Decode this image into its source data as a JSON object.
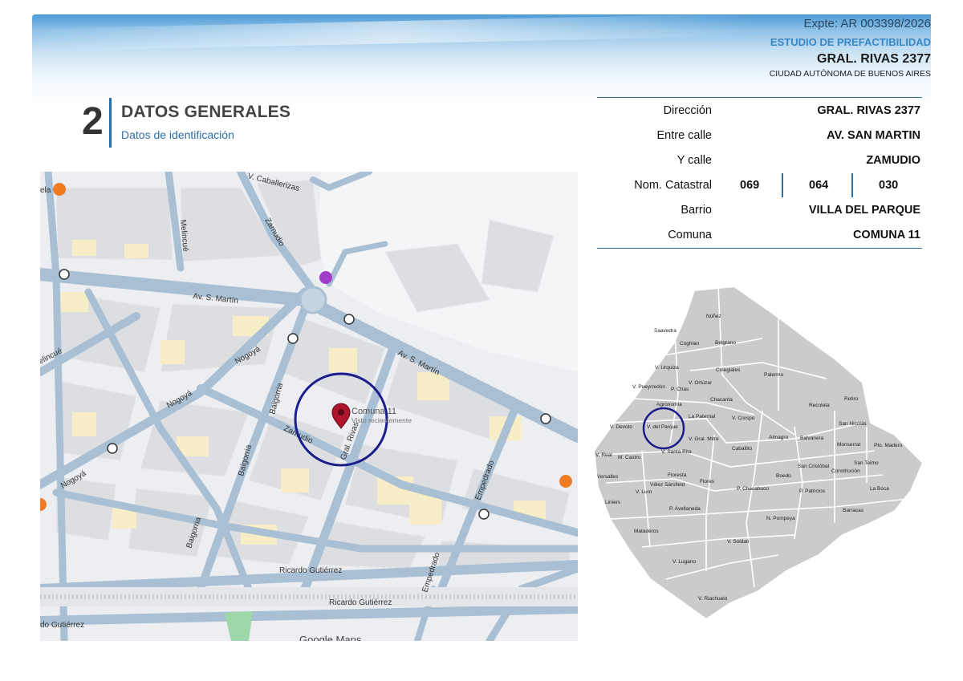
{
  "header": {
    "expte": "Expte: AR 003398/2026",
    "estudio": "ESTUDIO DE PREFACTIBILIDAD",
    "address": "GRAL. RIVAS 2377",
    "city": "CIUDAD AUTÓNOMA DE BUENOS AIRES"
  },
  "section": {
    "number": "2",
    "title": "DATOS GENERALES",
    "subtitle": "Datos de identificación"
  },
  "info": {
    "direccion_label": "Dirección",
    "direccion_value": "GRAL. RIVAS 2377",
    "entre_label": "Entre calle",
    "entre_value": "AV. SAN MARTIN",
    "ycalle_label": "Y calle",
    "ycalle_value": "ZAMUDIO",
    "catastral_label": "Nom. Catastral",
    "catastral_1": "069",
    "catastral_2": "064",
    "catastral_3": "030",
    "barrio_label": "Barrio",
    "barrio_value": "VILLA DEL PARQUE",
    "comuna_label": "Comuna",
    "comuna_value": "COMUNA 11"
  },
  "street_map": {
    "streets": {
      "caballerizas": "V. Caballerizas",
      "melincue": "Melincué",
      "melincue_left": "elincué",
      "zamudio_north": "Zamudio",
      "av_sm_1": "Av. S. Martín",
      "av_sm_2": "Av. S. Martín",
      "nogoya_1": "Nogoyá",
      "nogoya_2": "Nogoyá",
      "nogoya_3": "Nogoyá",
      "baigorria_1": "Baigorria",
      "baigorria_2": "Baigorria",
      "baigorria_3": "Baigorria",
      "zamudio": "Zamudio",
      "gral_rivas": "Gral. Rivas",
      "empedrado_1": "Empedrado",
      "empedrado_2": "Empedrado",
      "ricardo_1": "Ricardo Gutiérrez",
      "ricardo_2": "Ricardo Gutiérrez",
      "ricardo_3": "do Gutiérrez",
      "pela": "ela"
    },
    "marker_title": "Comuna 11",
    "marker_sub": "Visto recientemente",
    "footer_brand": "Google Maps",
    "colors": {
      "road": "#a9bfd3",
      "block": "#dfe1e4",
      "highlight_circle": "#1c1c8c",
      "marker": "#b0132c"
    }
  },
  "context_map": {
    "labels": {
      "nunez": "Núñez",
      "saavedra": "Saavedra",
      "coghlan": "Coghlan",
      "belgrano": "Belgrano",
      "v_urquiza": "V. Urquiza",
      "colegiales": "Colegiales",
      "v_ortuzar": "V. Ortúzar",
      "v_pueyrredon": "V. Pueyrredón",
      "p_chas": "P. Chas",
      "palermo": "Palermo",
      "chacarita": "Chacarita",
      "agronomia": "Agronomía",
      "recoleta": "Recoleta",
      "retiro": "Retiro",
      "la_paternal": "La Paternal",
      "v_crespo": "V. Crespo",
      "v_devoto": "V. Devoto",
      "v_del_parque": "V. del Parque",
      "v_gral_mitre": "V. Gral. Mitre",
      "san_nicolas": "San Nicolás",
      "almagro": "Almagro",
      "balvanera": "Balvanera",
      "monserrat": "Monserrat",
      "pto_madero": "Pto. Madero",
      "caballito": "Caballito",
      "v_real": "V. Real",
      "m_castro": "M. Castro",
      "v_santa_rita": "V. Santa Rita",
      "san_cristobal": "San Cristóbal",
      "san_telmo": "San Telmo",
      "constitucion": "Constitución",
      "versalles": "Versalles",
      "floresta": "Floresta",
      "boedo": "Boedo",
      "velez": "Vélez Sársfield",
      "flores": "Flores",
      "p_chacabuco": "P. Chacabuco",
      "p_patricios": "P. Patricios",
      "la_boca": "La Boca",
      "liniers": "Liniers",
      "v_luro": "V. Luro",
      "p_avellaneda": "P. Avellaneda",
      "barracas": "Barracas",
      "n_pompeya": "N. Pompeya",
      "mataderos": "Mataderos",
      "v_soldati": "V. Soldati",
      "v_lugano": "V. Lugano",
      "v_riachuelo": "V. Riachuelo"
    },
    "colors": {
      "fill": "#cbcbcb",
      "border": "#ffffff",
      "highlight_circle": "#1c1c8c"
    }
  }
}
